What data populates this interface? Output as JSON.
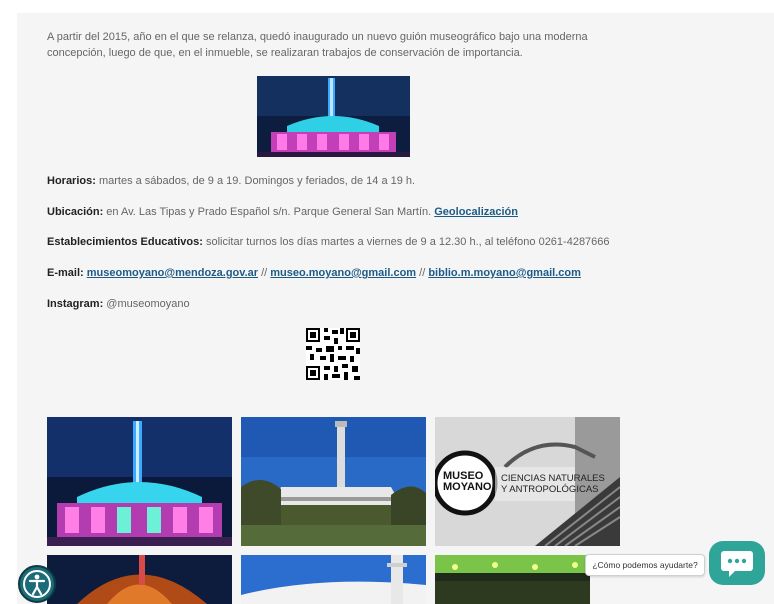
{
  "intro": {
    "text": "A partir del 2015, año en el que se relanza, quedó inaugurado un nuevo guión museográfico bajo una moderna concepción, luego de que, en el inmueble, se realizaran trabajos de conservación de importancia."
  },
  "info": {
    "horarios_label": "Horarios:",
    "horarios_text": " martes a sábados, de 9 a 19. Domingos y feriados, de 14 a 19 h.",
    "ubicacion_label": "Ubicación:",
    "ubicacion_text": " en Av. Las Tipas y Prado Español s/n. Parque General San Martín. ",
    "ubicacion_link": "Geolocalización",
    "educativos_label": "Establecimientos Educativos:",
    "educativos_text": " solicitar turnos los días martes a viernes de 9 a 12.30 h., al teléfono 0261-4287666",
    "email_label": "E-mail:",
    "email_1": "museomoyano@mendoza.gov.ar",
    "email_sep_1": " // ",
    "email_2": "museo.moyano@gmail.com",
    "email_sep_2": " // ",
    "email_3": "biblio.m.moyano@gmail.com",
    "instagram_label": "Instagram:",
    "instagram_text": " @museomoyano"
  },
  "gallery": {
    "museo_logo_line1": "MUSEO",
    "museo_logo_line2": "MOYANO",
    "museo_sign_line1": "CIENCIAS NATURALES",
    "museo_sign_line2": "Y ANTROPOLÓGICAS"
  },
  "chat": {
    "prompt": "¿Cómo podemos ayudarte?"
  },
  "colors": {
    "link": "#1d5b86",
    "chat_accent": "#2fa59a",
    "accessibility": "#1c6b78"
  },
  "icons": {
    "accessibility": "accessibility-person-icon",
    "chat": "chat-dots-icon"
  }
}
